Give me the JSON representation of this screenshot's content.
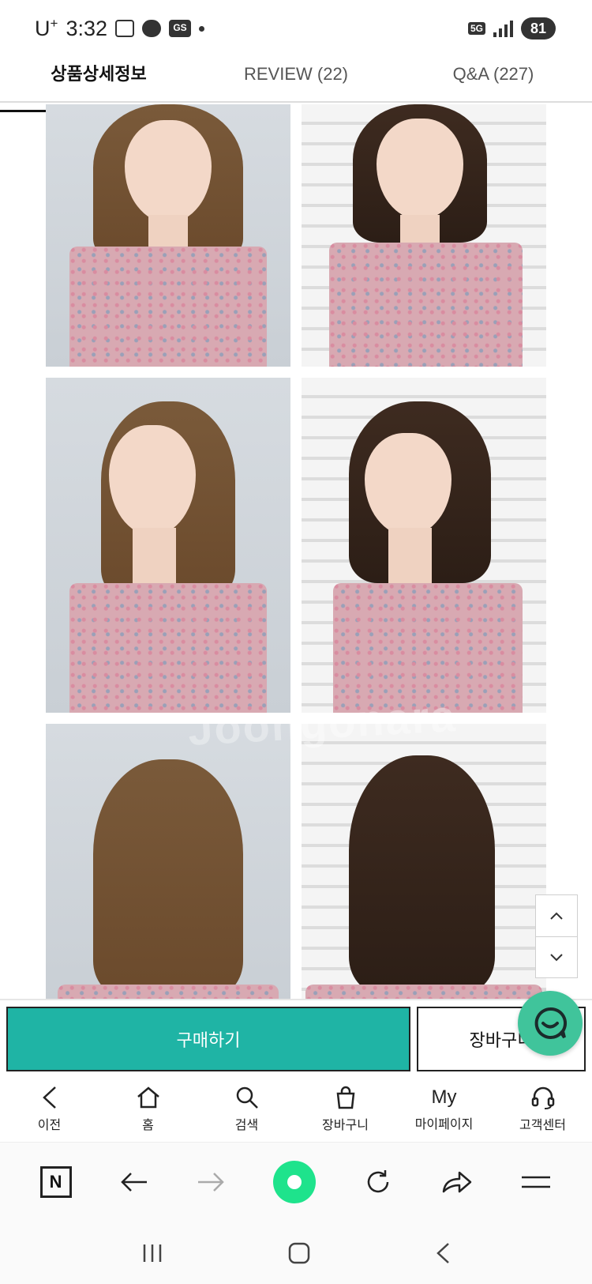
{
  "status_bar": {
    "carrier": "U",
    "carrier_sup": "+",
    "time": "3:32",
    "gs_badge": "GS",
    "network": "5G",
    "battery": "81"
  },
  "tabs": [
    {
      "label": "상품상세정보",
      "active": true
    },
    {
      "label": "REVIEW (22)",
      "active": false
    },
    {
      "label": "Q&A (227)",
      "active": false
    }
  ],
  "watermark": "Joongonara",
  "purchase_bar": {
    "buy_label": "구매하기",
    "cart_label": "장바구니"
  },
  "bottom_nav": [
    {
      "label": "이전",
      "icon": "chevron-left-icon"
    },
    {
      "label": "홈",
      "icon": "home-icon"
    },
    {
      "label": "검색",
      "icon": "search-icon"
    },
    {
      "label": "장바구니",
      "icon": "shopping-bag-icon"
    },
    {
      "label": "마이페이지",
      "icon": "my-text-icon",
      "icon_text": "My"
    },
    {
      "label": "고객센터",
      "icon": "headset-icon"
    }
  ],
  "browser_toolbar": [
    "naver-n-icon",
    "back-arrow-icon",
    "forward-arrow-icon",
    "green-dot-icon",
    "refresh-icon",
    "share-icon",
    "menu-icon"
  ],
  "colors": {
    "buy_button": "#1fb4a5",
    "chat_button": "#40c49b",
    "green_dot": "#1ee38c"
  }
}
